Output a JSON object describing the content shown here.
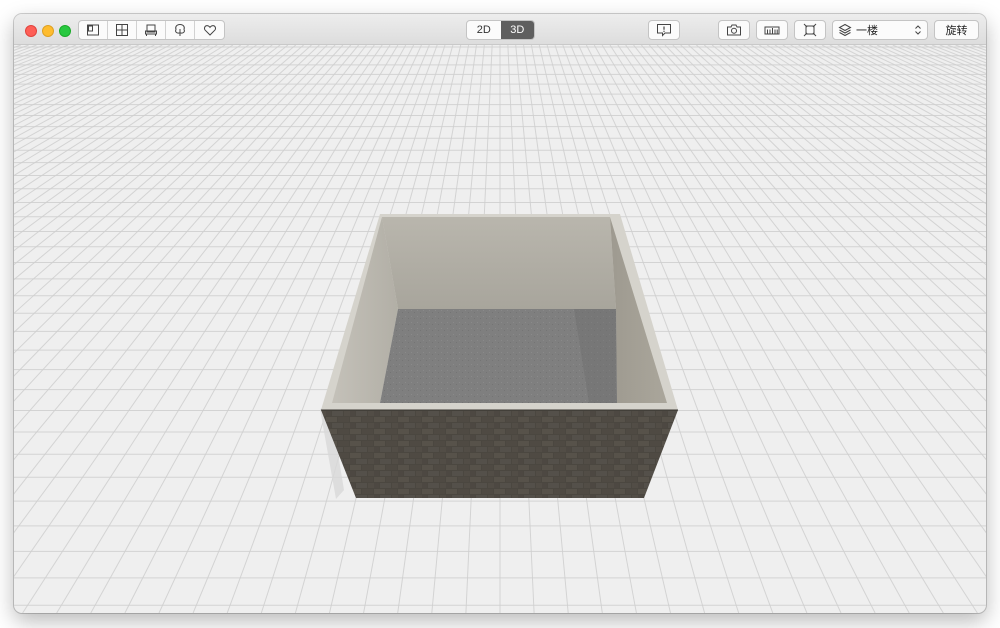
{
  "toolbar": {
    "tools": [
      {
        "name": "layout-icon"
      },
      {
        "name": "grid-room-icon"
      },
      {
        "name": "furniture-icon"
      },
      {
        "name": "tree-icon"
      },
      {
        "name": "heart-icon"
      }
    ],
    "view_modes": [
      "2D",
      "3D"
    ],
    "active_view_mode": "3D",
    "floor_select": {
      "value": "一楼"
    },
    "rotate_label": "旋转"
  },
  "scene": {
    "ground_color": "#efefef",
    "grid_color": "#cfcfcf",
    "exterior_wall_texture": "dark-stone-brick",
    "interior_wall_color": "#aeaaa0",
    "floor_color": "#7f7f7f",
    "wall_top_color": "#d5d3cc"
  },
  "colors": {
    "active_mode_bg": "#5f5f5f",
    "close": "#fe5f57",
    "minimize": "#febc2e",
    "zoom": "#28c840"
  }
}
